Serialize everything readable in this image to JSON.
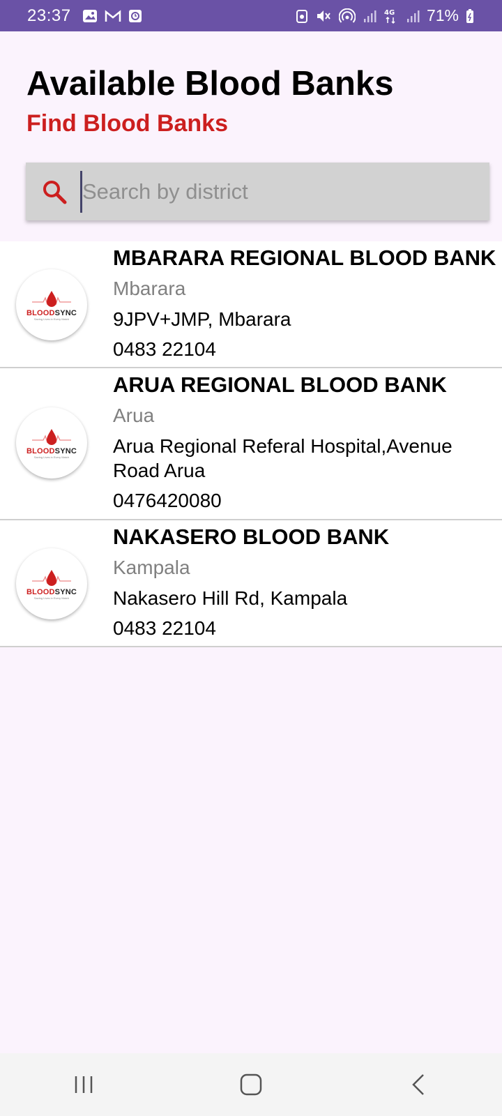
{
  "status_bar": {
    "time": "23:37",
    "battery": "71%",
    "left_icons": [
      "gallery-icon",
      "gmail-icon",
      "clock-notification-icon"
    ],
    "right_icons": [
      "alarm-icon",
      "mute-icon",
      "hotspot-icon",
      "signal-icon",
      "4g-data-icon",
      "signal-icon",
      "battery-icon"
    ],
    "background": "#6a52a6"
  },
  "header": {
    "title": "Available Blood Banks",
    "subtitle": "Find Blood Banks",
    "subtitle_color": "#cc1f1f"
  },
  "search": {
    "placeholder": "Search by district",
    "value": "",
    "icon": "search-icon"
  },
  "blood_banks": [
    {
      "name": "MBARARA REGIONAL BLOOD BANK",
      "district": "Mbarara",
      "address": "9JPV+JMP, Mbarara",
      "phone": "0483 22104"
    },
    {
      "name": "ARUA REGIONAL BLOOD BANK",
      "district": "Arua",
      "address": "Arua Regional Referal Hospital,Avenue Road Arua",
      "phone": "0476420080"
    },
    {
      "name": "NAKASERO BLOOD BANK",
      "district": "Kampala",
      "address": "Nakasero Hill Rd, Kampala",
      "phone": "0483 22104"
    }
  ],
  "logo": {
    "brand_red": "BLOOD",
    "brand_dark": "SYNC",
    "tagline": "Saving Lives in Every Match"
  },
  "nav_bar": {
    "buttons": [
      "recent-apps-icon",
      "home-icon",
      "back-icon"
    ]
  }
}
